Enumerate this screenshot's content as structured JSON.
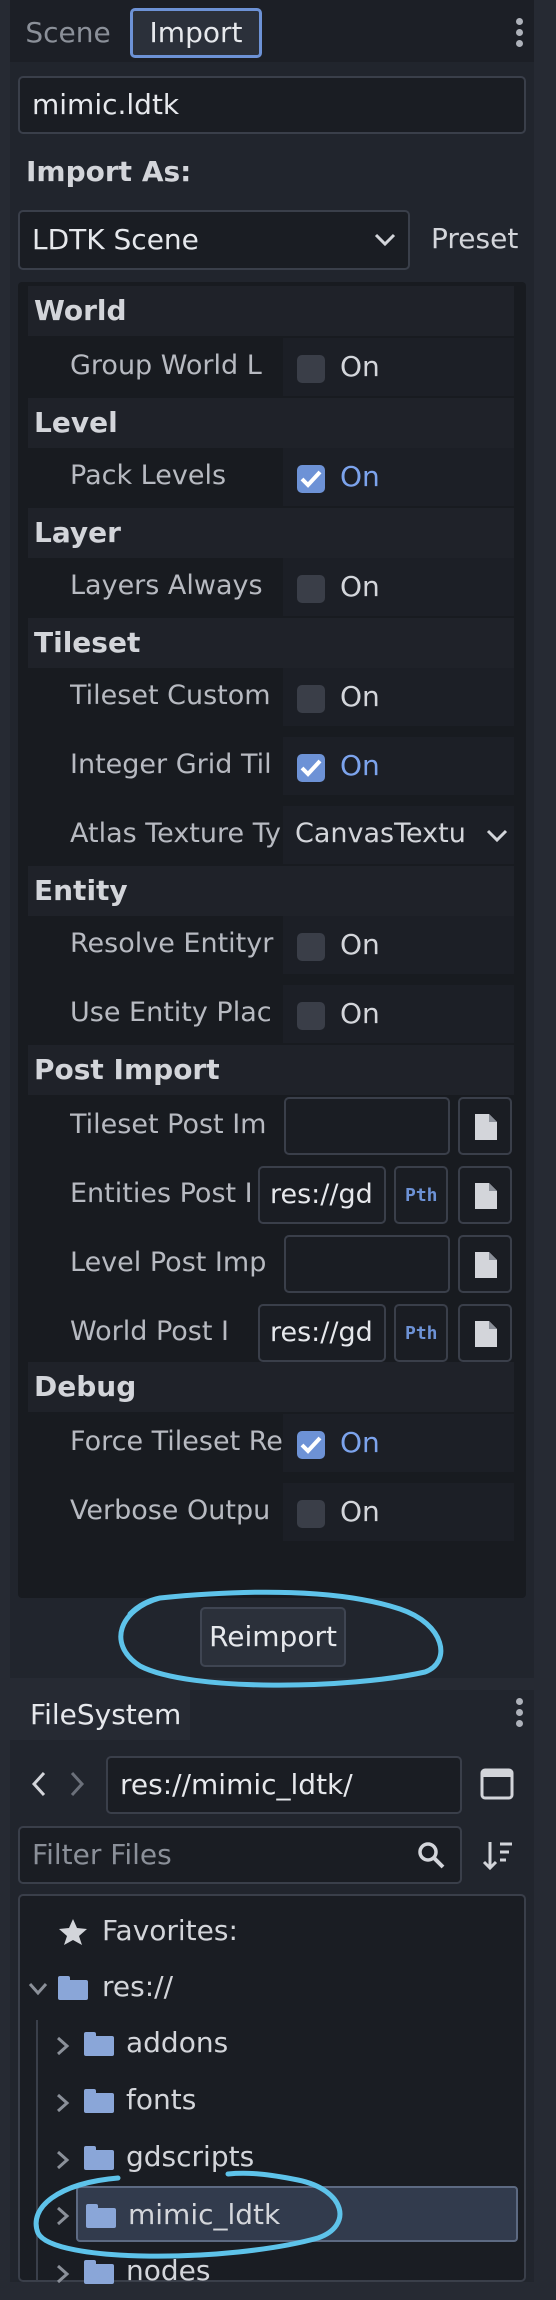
{
  "tabs": {
    "scene": "Scene",
    "import": "Import"
  },
  "file_name": "mimic.ldtk",
  "import_as": {
    "label": "Import As:",
    "selected": "LDTK Scene",
    "preset_label": "Preset"
  },
  "sections": {
    "world": "World",
    "level": "Level",
    "layer": "Layer",
    "tileset": "Tileset",
    "entity": "Entity",
    "post_import": "Post Import",
    "debug": "Debug"
  },
  "props": {
    "group_world": {
      "label": "Group World L",
      "value": "On",
      "checked": false
    },
    "pack_levels": {
      "label": "Pack Levels",
      "value": "On",
      "checked": true
    },
    "layers_always": {
      "label": "Layers Always",
      "value": "On",
      "checked": false
    },
    "tileset_custom": {
      "label": "Tileset Custom",
      "value": "On",
      "checked": false
    },
    "integer_grid": {
      "label": "Integer Grid Til",
      "value": "On",
      "checked": true
    },
    "atlas_texture": {
      "label": "Atlas Texture Ty",
      "value": "CanvasTextu"
    },
    "resolve_entity": {
      "label": "Resolve Entityr",
      "value": "On",
      "checked": false
    },
    "use_entity": {
      "label": "Use Entity Plac",
      "value": "On",
      "checked": false
    },
    "tileset_post": {
      "label": "Tileset Post Im",
      "value": ""
    },
    "entities_post": {
      "label": "Entities Post I",
      "value": "res://gd",
      "pth": "Pth"
    },
    "level_post": {
      "label": "Level Post Imp",
      "value": ""
    },
    "world_post": {
      "label": "World Post I",
      "value": "res://gd",
      "pth": "Pth"
    },
    "force_tileset": {
      "label": "Force Tileset Re",
      "value": "On",
      "checked": true
    },
    "verbose": {
      "label": "Verbose Outpu",
      "value": "On",
      "checked": false
    }
  },
  "reimport_label": "Reimport",
  "filesystem": {
    "tab": "FileSystem",
    "path": "res://mimic_ldtk/",
    "filter_placeholder": "Filter Files",
    "favorites": "Favorites:",
    "root": "res://",
    "folders": [
      "addons",
      "fonts",
      "gdscripts",
      "mimic_ldtk",
      "nodes"
    ]
  },
  "colors": {
    "accent": "#6d92d6",
    "annotation": "#5ec3ea",
    "folder": "#8aa6d8"
  }
}
